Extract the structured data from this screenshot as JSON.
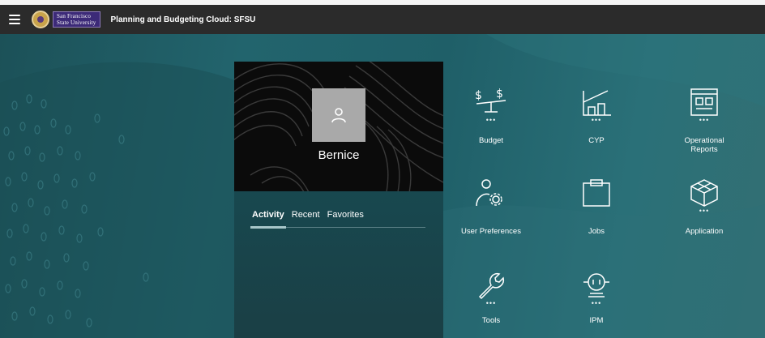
{
  "header": {
    "logo_line1": "San Francisco",
    "logo_line2": "State University",
    "app_title": "Planning and Budgeting Cloud: SFSU"
  },
  "profile": {
    "user_name": "Bernice",
    "tabs": [
      {
        "label": "Activity",
        "active": true
      },
      {
        "label": "Recent",
        "active": false
      },
      {
        "label": "Favorites",
        "active": false
      }
    ]
  },
  "tiles": [
    {
      "label": "Budget",
      "icon": "budget-scale-icon",
      "more": "•••"
    },
    {
      "label": "CYP",
      "icon": "cyp-chart-icon",
      "more": "•••"
    },
    {
      "label": "Operational Reports",
      "icon": "reports-icon",
      "more": "•••"
    },
    {
      "label": "User Preferences",
      "icon": "user-preferences-icon",
      "more": ""
    },
    {
      "label": "Jobs",
      "icon": "jobs-icon",
      "more": ""
    },
    {
      "label": "Application",
      "icon": "application-cube-icon",
      "more": "•••"
    },
    {
      "label": "Tools",
      "icon": "wrench-icon",
      "more": "•••"
    },
    {
      "label": "IPM",
      "icon": "ipm-robot-icon",
      "more": "•••"
    }
  ],
  "colors": {
    "topbar": "#2b2b2b",
    "background": "#1f5d66",
    "card_header": "#0b0b0b",
    "avatar": "#a9a9a9"
  }
}
